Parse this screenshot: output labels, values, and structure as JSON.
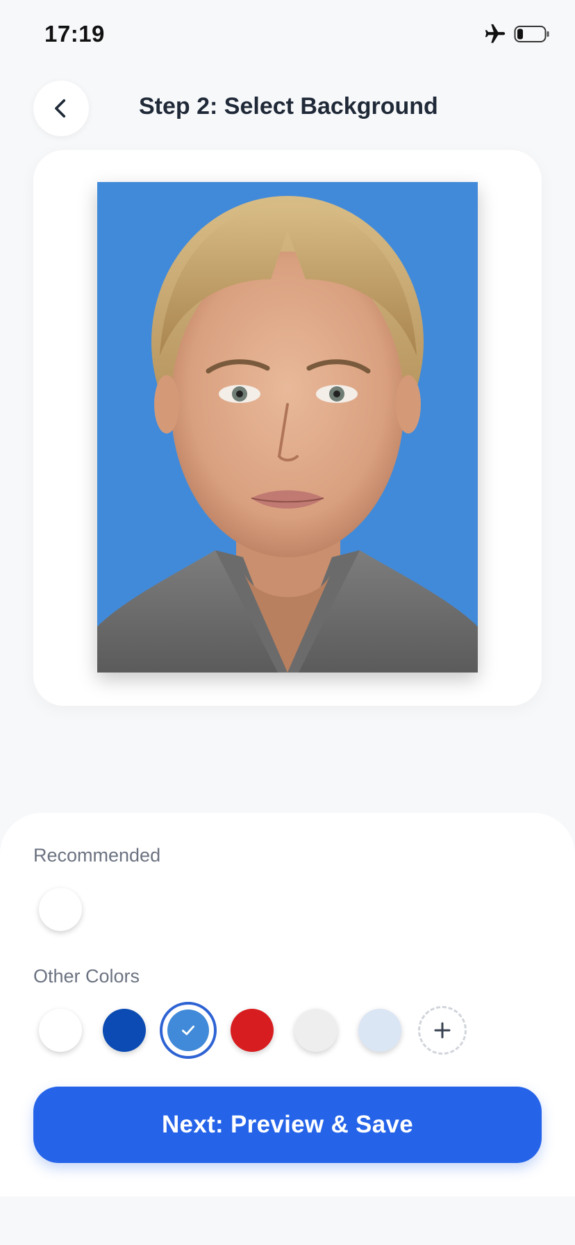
{
  "status_bar": {
    "time": "17:19",
    "icons": [
      "airplane-mode-icon",
      "battery-icon"
    ]
  },
  "header": {
    "back_icon": "chevron-left-icon",
    "title": "Step 2: Select Background"
  },
  "photo_preview": {
    "background_color": "#418ad9",
    "description": "passport-photo-portrait"
  },
  "background_picker": {
    "recommended_label": "Recommended",
    "recommended": [
      {
        "name": "white",
        "color": "#ffffff"
      }
    ],
    "other_label": "Other Colors",
    "others": [
      {
        "name": "white",
        "color": "#ffffff",
        "selected": false
      },
      {
        "name": "dark-blue",
        "color": "#0b4bb3",
        "selected": false
      },
      {
        "name": "sky-blue",
        "color": "#418ad9",
        "selected": true
      },
      {
        "name": "red",
        "color": "#d71d1f",
        "selected": false
      },
      {
        "name": "light-gray",
        "color": "#eeeeee",
        "selected": false
      },
      {
        "name": "pale-blue",
        "color": "#dbe6f5",
        "selected": false
      }
    ],
    "add_icon": "plus-icon",
    "selected_icon": "checkmark-icon"
  },
  "actions": {
    "next_label": "Next: Preview & Save"
  },
  "colors": {
    "accent": "#2563e9",
    "page_background": "#f7f8fa"
  }
}
